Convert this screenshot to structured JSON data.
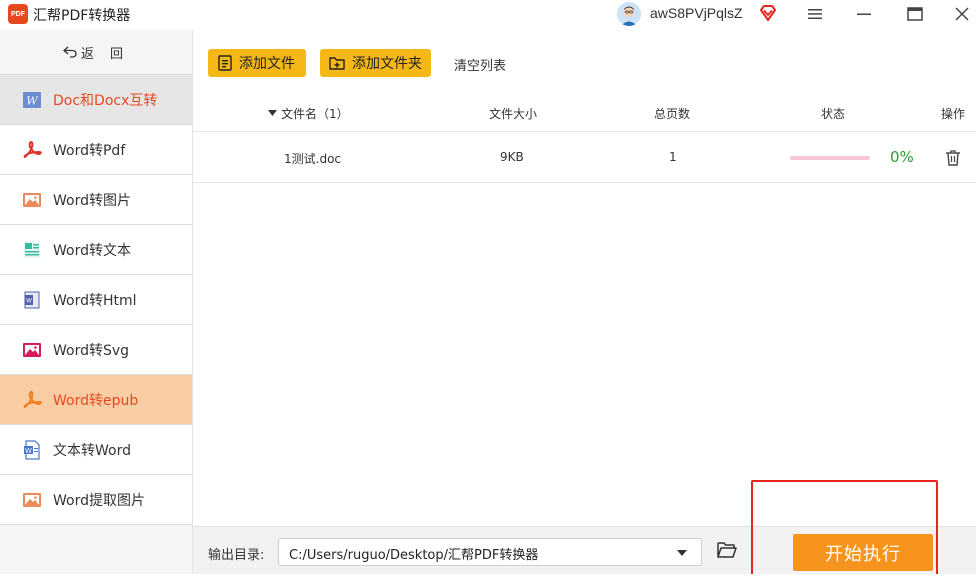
{
  "app": {
    "logo_text": "PDF",
    "title": "汇帮PDF转换器",
    "username": "awS8PVjPqlsZ"
  },
  "sidebar": {
    "back_label": "返 回",
    "items": [
      {
        "label": "Doc和Docx互转",
        "icon": "word-doc-icon",
        "state": "selected-gray"
      },
      {
        "label": "Word转Pdf",
        "icon": "pdf-icon",
        "state": "normal"
      },
      {
        "label": "Word转图片",
        "icon": "image-icon",
        "state": "normal"
      },
      {
        "label": "Word转文本",
        "icon": "text-doc-icon",
        "state": "normal"
      },
      {
        "label": "Word转Html",
        "icon": "html-icon",
        "state": "normal"
      },
      {
        "label": "Word转Svg",
        "icon": "svg-image-icon",
        "state": "normal"
      },
      {
        "label": "Word转epub",
        "icon": "epub-icon",
        "state": "active"
      },
      {
        "label": "文本转Word",
        "icon": "word-file-icon",
        "state": "normal"
      },
      {
        "label": "Word提取图片",
        "icon": "extract-image-icon",
        "state": "normal"
      }
    ]
  },
  "toolbar": {
    "add_file": "添加文件",
    "add_folder": "添加文件夹",
    "clear_list": "清空列表"
  },
  "table": {
    "headers": {
      "filename": "文件名（1）",
      "size": "文件大小",
      "pages": "总页数",
      "status": "状态",
      "action": "操作"
    },
    "rows": [
      {
        "filename": "1测试.doc",
        "size": "9KB",
        "pages": "1",
        "progress": 0,
        "progress_text": "0%"
      }
    ]
  },
  "footer": {
    "output_label": "输出目录:",
    "output_path": "C:/Users/ruguo/Desktop/汇帮PDF转换器",
    "start_button": "开始执行"
  },
  "colors": {
    "accent_orange": "#f7941d",
    "brand_red": "#e8481f",
    "yellow_button": "#f6b817",
    "active_item_bg": "#f8cda4",
    "progress_green": "#2e9b2e",
    "highlight_red": "#e8231c"
  }
}
